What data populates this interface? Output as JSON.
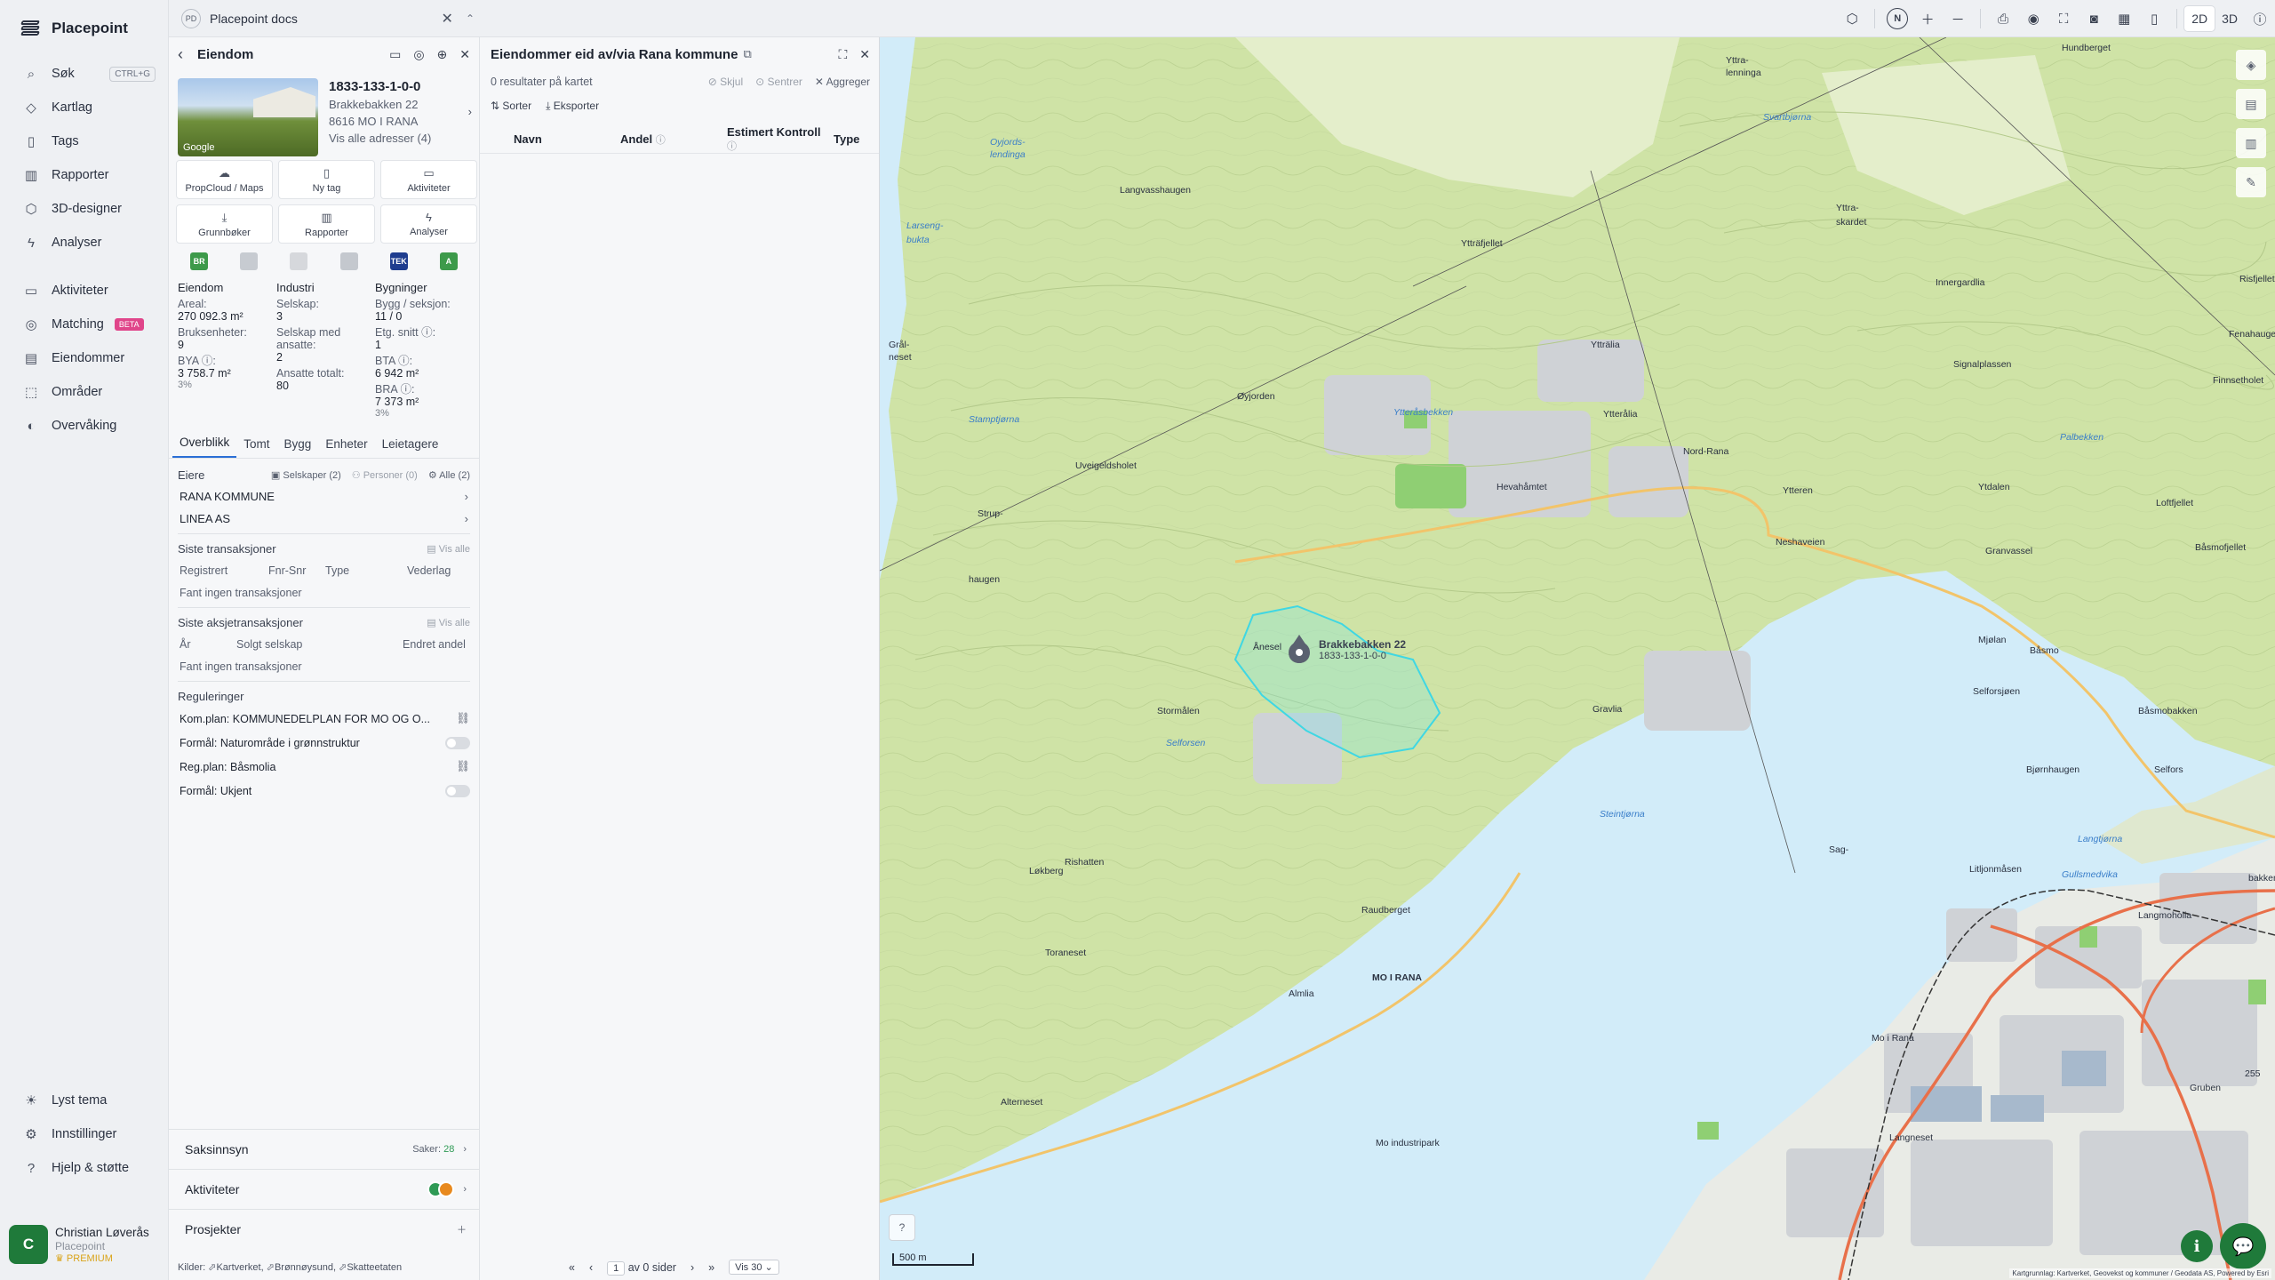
{
  "app": {
    "name": "Placepoint"
  },
  "nav": {
    "main": [
      {
        "label": "Søk",
        "icon": "search-icon",
        "shortcut": "CTRL+G"
      },
      {
        "label": "Kartlag",
        "icon": "layers-icon"
      },
      {
        "label": "Tags",
        "icon": "bookmark-icon"
      },
      {
        "label": "Rapporter",
        "icon": "bar-chart-icon"
      },
      {
        "label": "3D-designer",
        "icon": "cube-icon"
      },
      {
        "label": "Analyser",
        "icon": "bolt-icon"
      }
    ],
    "secondary": [
      {
        "label": "Aktiviteter",
        "icon": "chat-icon"
      },
      {
        "label": "Matching",
        "icon": "target-icon",
        "badge": "BETA"
      },
      {
        "label": "Eiendommer",
        "icon": "building-icon"
      },
      {
        "label": "Områder",
        "icon": "area-icon"
      },
      {
        "label": "Overvåking",
        "icon": "watch-icon"
      }
    ],
    "bottom": [
      {
        "label": "Lyst tema",
        "icon": "sun-icon"
      },
      {
        "label": "Innstillinger",
        "icon": "gear-icon"
      },
      {
        "label": "Hjelp & støtte",
        "icon": "help-icon"
      }
    ]
  },
  "user": {
    "initial": "C",
    "name": "Christian Løverås",
    "org": "Placepoint",
    "plan": "PREMIUM"
  },
  "topbar": {
    "doc_badge": "PD",
    "doc_title": "Placepoint docs",
    "compass": "N",
    "view_2d": "2D",
    "view_3d": "3D"
  },
  "property": {
    "header": "Eiendom",
    "id": "1833-133-1-0-0",
    "address_line1": "Brakkebakken 22",
    "address_line2": "8616 MO I RANA",
    "all_addresses": "Vis alle adresser (4)",
    "photo_credit": "Google",
    "actions": [
      {
        "label": "PropCloud / Maps",
        "icon": "cloud-icon"
      },
      {
        "label": "Ny tag",
        "icon": "bookmark-icon"
      },
      {
        "label": "Aktiviteter",
        "icon": "chat-icon"
      },
      {
        "label": "Grunnbøker",
        "icon": "download-icon"
      },
      {
        "label": "Rapporter",
        "icon": "bar-chart-icon"
      },
      {
        "label": "Analyser",
        "icon": "bolt-icon"
      }
    ],
    "badges": [
      {
        "text": "BR",
        "color": "#3d9a4a"
      },
      {
        "text": "",
        "color": "#c7cbd1"
      },
      {
        "text": "",
        "color": "#d6d8dc"
      },
      {
        "text": "",
        "color": "#c4c8ce"
      },
      {
        "text": "TEK",
        "color": "#1f3d8f"
      },
      {
        "text": "A",
        "color": "#3d9a4a"
      }
    ],
    "stats": {
      "eiendom": {
        "title": "Eiendom",
        "areal_label": "Areal:",
        "areal_value": "270 092.3 m²",
        "bruksenheter_label": "Bruksenheter:",
        "bruksenheter_value": "9",
        "bya_label": "BYA ⓘ:",
        "bya_value": "3 758.7 m²",
        "bya_pct": "3%"
      },
      "industri": {
        "title": "Industri",
        "selskap_label": "Selskap:",
        "selskap_value": "3",
        "ansatte_label": "Selskap med ansatte:",
        "ansatte_value": "2",
        "totalt_label": "Ansatte totalt:",
        "totalt_value": "80"
      },
      "bygninger": {
        "title": "Bygninger",
        "bygg_label": "Bygg / seksjon:",
        "bygg_value": "11 / 0",
        "etg_label": "Etg. snitt ⓘ:",
        "etg_value": "1",
        "bta_label": "BTA ⓘ:",
        "bta_value": "6 942 m²",
        "bra_label": "BRA ⓘ:",
        "bra_value": "7 373 m²",
        "bra_pct": "3%"
      }
    },
    "tabs": [
      "Overblikk",
      "Tomt",
      "Bygg",
      "Enheter",
      "Leietagere"
    ],
    "owners": {
      "title": "Eiere",
      "filter_companies": "Selskaper (2)",
      "filter_persons": "Personer (0)",
      "filter_all": "Alle (2)",
      "list": [
        "RANA KOMMUNE",
        "LINEA AS"
      ]
    },
    "transactions": {
      "title": "Siste transaksjoner",
      "show_all": "Vis alle",
      "columns": [
        "Registrert",
        "Fnr-Snr",
        "Type",
        "Vederlag"
      ],
      "empty": "Fant ingen transaksjoner"
    },
    "share_transactions": {
      "title": "Siste aksjetransaksjoner",
      "show_all": "Vis alle",
      "columns": [
        "År",
        "Solgt selskap",
        "Endret andel"
      ],
      "empty": "Fant ingen transaksjoner"
    },
    "regulations": {
      "title": "Reguleringer",
      "rows": [
        {
          "text": "Kom.plan: KOMMUNEDELPLAN FOR MO OG O...",
          "kind": "link"
        },
        {
          "text": "Formål: Naturområde i grønnstruktur",
          "kind": "toggle"
        },
        {
          "text": "Reg.plan: Båsmolia",
          "kind": "link"
        },
        {
          "text": "Formål: Ukjent",
          "kind": "toggle"
        }
      ]
    },
    "accordions": {
      "saksinnsyn": "Saksinnsyn",
      "saker_label": "Saker:",
      "saker_count": "28",
      "aktiviteter": "Aktiviteter",
      "prosjekter": "Prosjekter"
    },
    "sources_label": "Kilder:",
    "sources": [
      "Kartverket",
      "Brønnøysund",
      "Skatteetaten"
    ]
  },
  "owned": {
    "title": "Eiendommer eid av/via Rana kommune",
    "results": "0 resultater på kartet",
    "hide": "Skjul",
    "center": "Sentrer",
    "aggregate": "Aggreger",
    "sort": "Sorter",
    "export": "Eksporter",
    "columns": [
      "Navn",
      "Andel",
      "Estimert Kontroll",
      "Type"
    ],
    "pager": {
      "page": "1",
      "of_label": "av 0 sider",
      "per_page": "Vis 30"
    }
  },
  "map": {
    "marker_label_1": "Brakkebakken 22",
    "marker_label_2": "1833-133-1-0-0",
    "scale": "500 m",
    "attribution": "Kartgrunnlag: Kartverket, Geovekst og kommuner / Geodata AS, Powered by Esri",
    "labels": [
      {
        "text": "Yttra-",
        "type": "place"
      },
      {
        "text": "lenninga",
        "type": "place"
      },
      {
        "text": "Hundberget",
        "type": "place"
      },
      {
        "text": "Svartbjørna",
        "type": "water"
      },
      {
        "text": "Oyjords-",
        "type": "water"
      },
      {
        "text": "lendinga",
        "type": "water"
      },
      {
        "text": "Langvasshaugen",
        "type": "place"
      },
      {
        "text": "Yttra-",
        "type": "place"
      },
      {
        "text": "skardet",
        "type": "place"
      },
      {
        "text": "Larseng-",
        "type": "water"
      },
      {
        "text": "bukta",
        "type": "water"
      },
      {
        "text": "Ytträfjellet",
        "type": "place"
      },
      {
        "text": "Innergardlia",
        "type": "place"
      },
      {
        "text": "Risfjellet",
        "type": "place"
      },
      {
        "text": "Grål-",
        "type": "place"
      },
      {
        "text": "neset",
        "type": "place"
      },
      {
        "text": "Ytträlia",
        "type": "place"
      },
      {
        "text": "Signalplassen",
        "type": "place"
      },
      {
        "text": "Fenahaugen",
        "type": "place"
      },
      {
        "text": "Øyjorden",
        "type": "place"
      },
      {
        "text": "Ytteråsbekken",
        "type": "water"
      },
      {
        "text": "Ytterålia",
        "type": "place"
      },
      {
        "text": "Finnsetholet",
        "type": "place"
      },
      {
        "text": "Stamptjørna",
        "type": "water"
      },
      {
        "text": "Palbekken",
        "type": "water"
      },
      {
        "text": "Uveigeldsholet",
        "type": "place"
      },
      {
        "text": "Nord-Rana",
        "type": "place"
      },
      {
        "text": "Strup-",
        "type": "place"
      },
      {
        "text": "Hevahåmtet",
        "type": "place"
      },
      {
        "text": "Ytteren",
        "type": "place"
      },
      {
        "text": "Ytdalen",
        "type": "place"
      },
      {
        "text": "Loftfjellet",
        "type": "place"
      },
      {
        "text": "Neshaveien",
        "type": "place"
      },
      {
        "text": "Granvassel",
        "type": "place"
      },
      {
        "text": "haugen",
        "type": "place"
      },
      {
        "text": "Båsmofjellet",
        "type": "place"
      },
      {
        "text": "Mjølan",
        "type": "place"
      },
      {
        "text": "Selforsjøen",
        "type": "place"
      },
      {
        "text": "Båsmo",
        "type": "place"
      },
      {
        "text": "Ånesel",
        "type": "place"
      },
      {
        "text": "Gravlia",
        "type": "place"
      },
      {
        "text": "Stormålen",
        "type": "place"
      },
      {
        "text": "Selforsen",
        "type": "water"
      },
      {
        "text": "Båsmobakken",
        "type": "place"
      },
      {
        "text": "Steintjørna",
        "type": "water"
      },
      {
        "text": "Bjørnhaugen",
        "type": "place"
      },
      {
        "text": "Selfors",
        "type": "place"
      },
      {
        "text": "Rishatten",
        "type": "place"
      },
      {
        "text": "Langtjørna",
        "type": "water"
      },
      {
        "text": "Sag-",
        "type": "place"
      },
      {
        "text": "bakken",
        "type": "place"
      },
      {
        "text": "Løkberg",
        "type": "place"
      },
      {
        "text": "Litljonmåsen",
        "type": "place"
      },
      {
        "text": "Gullsmedvika",
        "type": "water"
      },
      {
        "text": "Raudberget",
        "type": "place"
      },
      {
        "text": "Toraneset",
        "type": "place"
      },
      {
        "text": "Langmoholia",
        "type": "place"
      },
      {
        "text": "MO I RANA",
        "type": "bold"
      },
      {
        "text": "Almlia",
        "type": "place"
      },
      {
        "text": "Mo i Rana",
        "type": "place"
      },
      {
        "text": "Gruben",
        "type": "place"
      },
      {
        "text": "Alterneset",
        "type": "place"
      },
      {
        "text": "Langneset",
        "type": "place"
      },
      {
        "text": "Mo industripark",
        "type": "place"
      },
      {
        "text": "255",
        "type": "place"
      }
    ]
  }
}
